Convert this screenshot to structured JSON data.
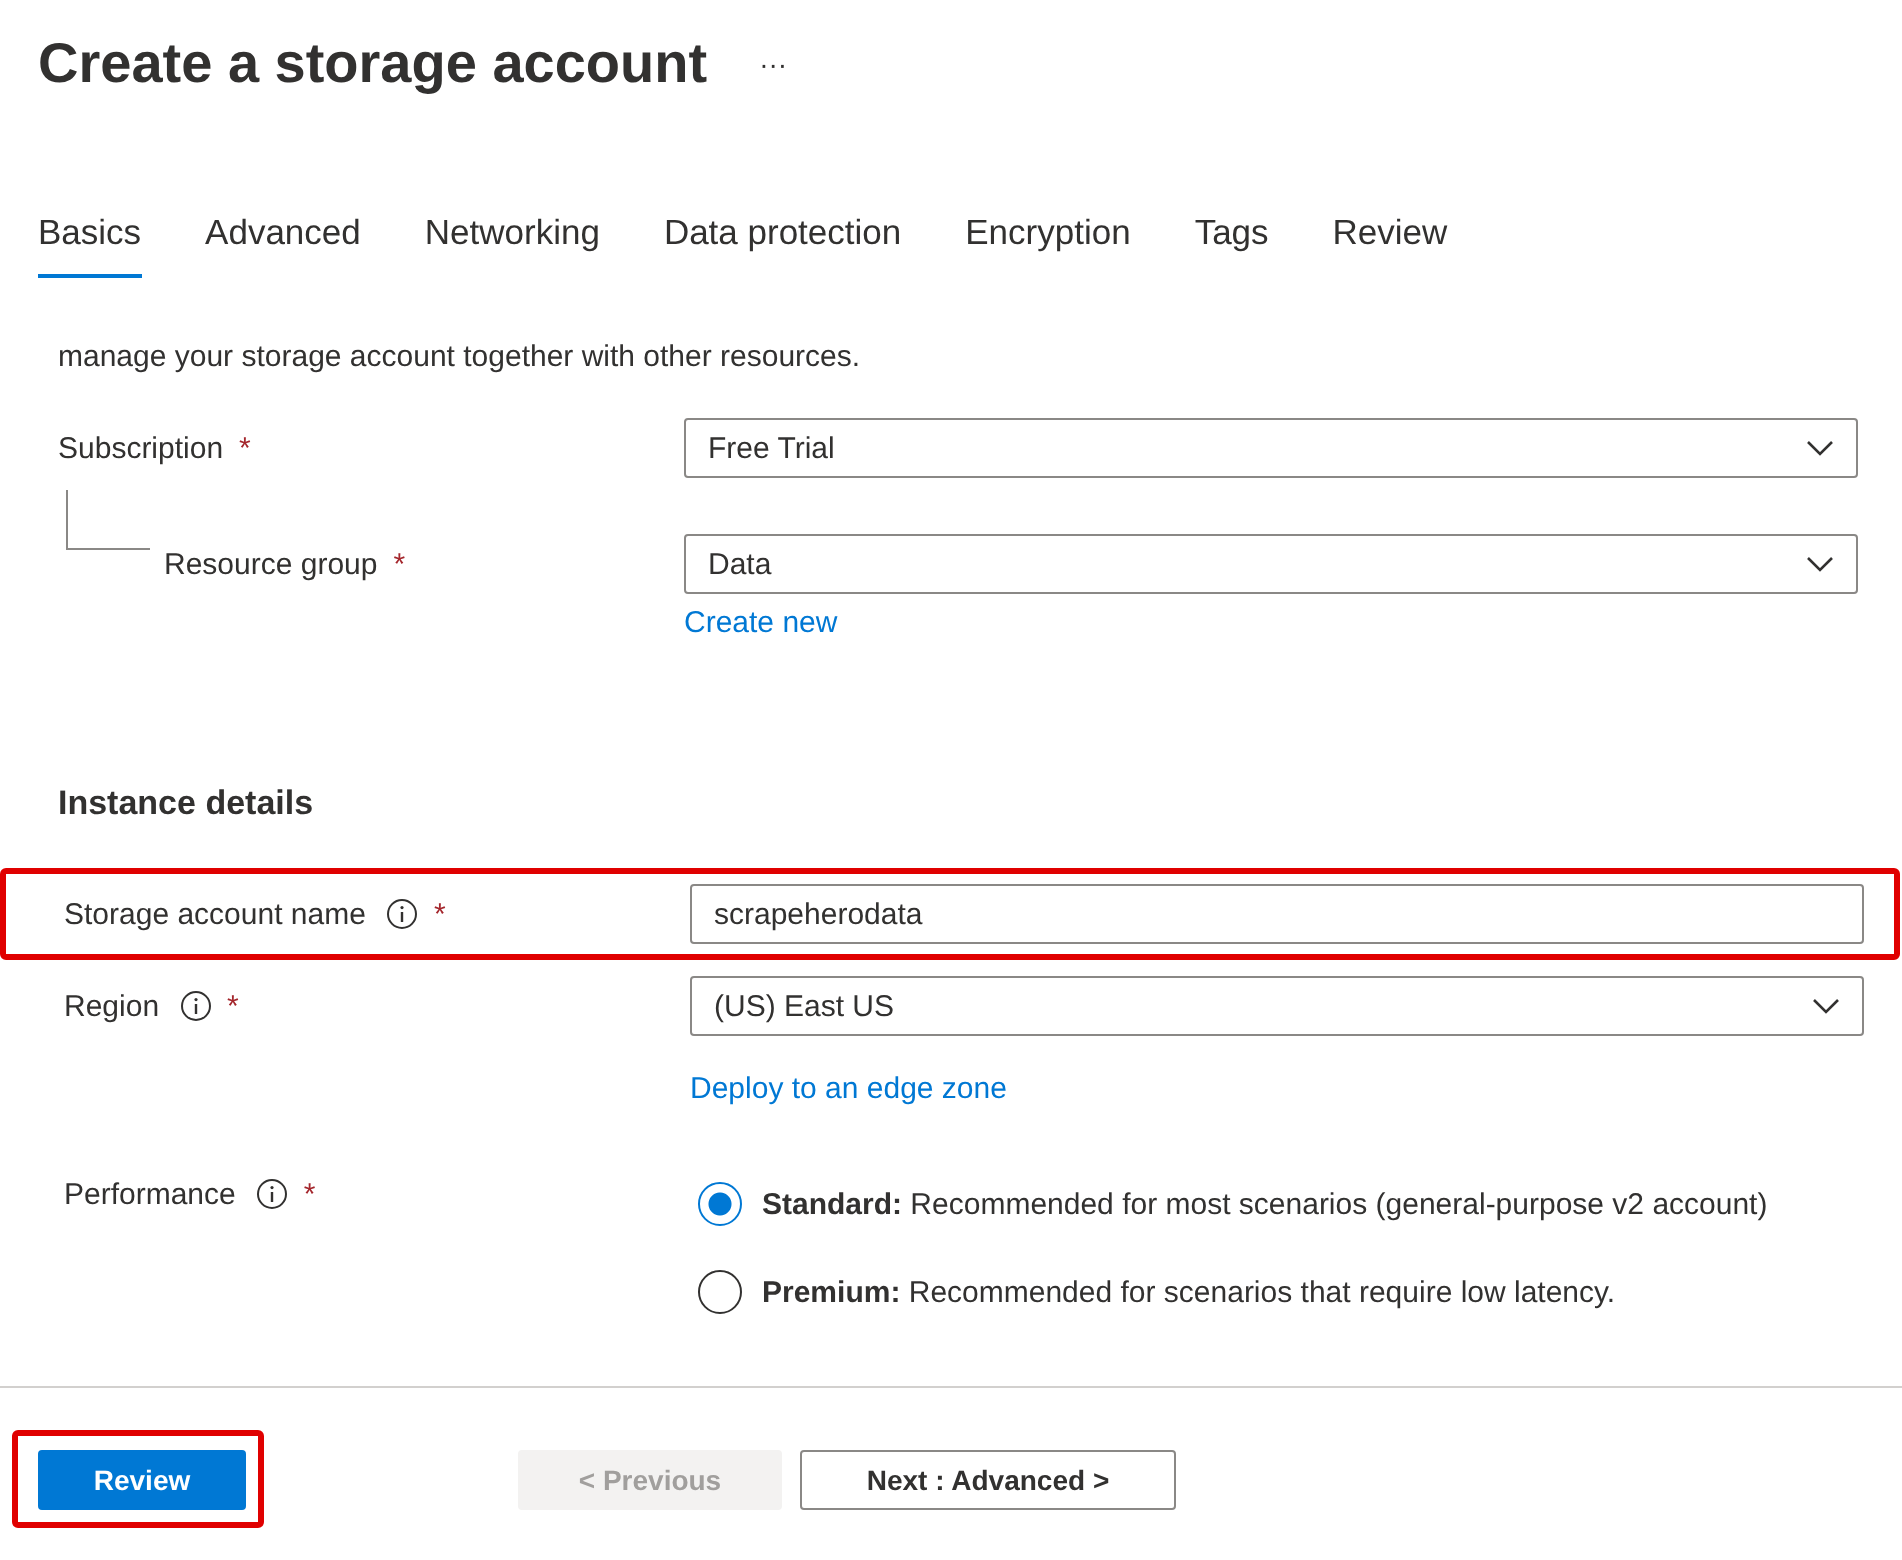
{
  "title": "Create a storage account",
  "more": "···",
  "tabs": [
    {
      "label": "Basics",
      "selected": true
    },
    {
      "label": "Advanced",
      "selected": false
    },
    {
      "label": "Networking",
      "selected": false
    },
    {
      "label": "Data protection",
      "selected": false
    },
    {
      "label": "Encryption",
      "selected": false
    },
    {
      "label": "Tags",
      "selected": false
    },
    {
      "label": "Review",
      "selected": false
    }
  ],
  "intro": "manage your storage account together with other resources.",
  "project_fields": [
    {
      "label": "Subscription",
      "required": "*",
      "kind": "select",
      "value": "Free Trial",
      "nested": false
    },
    {
      "label": "Resource group",
      "required": "*",
      "kind": "select",
      "value": "Data",
      "nested": true,
      "link": "Create new"
    }
  ],
  "instance_heading": "Instance details",
  "instance_fields": [
    {
      "label": "Storage account name",
      "required": "*",
      "info": true,
      "kind": "text",
      "value": "scrapeherodata",
      "highlighted": true
    },
    {
      "label": "Region",
      "required": "*",
      "info": true,
      "kind": "select",
      "value": "(US) East US",
      "link": "Deploy to an edge zone",
      "highlighted": false
    },
    {
      "label": "Performance",
      "required": "*",
      "info": true,
      "kind": "radio",
      "highlighted": false,
      "options": [
        {
          "name": "Standard:",
          "text": "Recommended for most scenarios (general-purpose v2 account)",
          "selected": true
        },
        {
          "name": "Premium:",
          "text": "Recommended for scenarios that require low latency.",
          "selected": false
        }
      ]
    }
  ],
  "buttons": [
    {
      "label": "Review",
      "kind": "primary",
      "disabled": false,
      "highlighted": true
    },
    {
      "label": "< Previous",
      "kind": "secondary",
      "disabled": true,
      "highlighted": false
    },
    {
      "label": "Next : Advanced >",
      "kind": "secondary",
      "disabled": false,
      "highlighted": false
    }
  ]
}
